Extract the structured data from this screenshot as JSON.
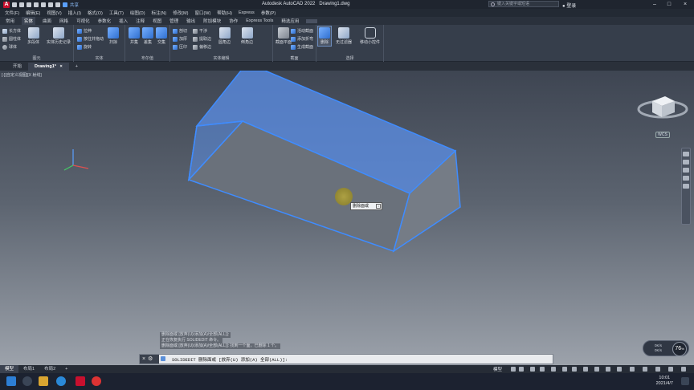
{
  "window": {
    "title": "Autodesk AutoCAD 2022",
    "filename": "Drawing1.dwg",
    "share_label": "共享",
    "search_placeholder": "键入关键字或短语",
    "login_label": "登录"
  },
  "menu": [
    "文件(F)",
    "编辑(E)",
    "视图(V)",
    "插入(I)",
    "格式(O)",
    "工具(T)",
    "绘图(D)",
    "标注(N)",
    "修改(M)",
    "窗口(W)",
    "帮助(H)",
    "Express",
    "参数(P)"
  ],
  "ribbon_tabs": [
    "常用",
    "实体",
    "曲面",
    "网格",
    "可视化",
    "参数化",
    "插入",
    "注释",
    "视图",
    "管理",
    "输出",
    "附加模块",
    "协作",
    "Express Tools",
    "精选应用"
  ],
  "ribbon_active_tab": "实体",
  "ribbon": {
    "primitive": {
      "label": "图元",
      "small": [
        "长方体",
        "圆柱体",
        "球体"
      ],
      "big": [
        "多段体"
      ]
    },
    "history": {
      "big": [
        "实体历史记录"
      ]
    },
    "solid": {
      "label": "实体",
      "small": [
        "拉伸",
        "放样",
        "旋转",
        "按住并拖动",
        "扫掠"
      ]
    },
    "boolean": {
      "label": "布尔值",
      "big": [
        "并集",
        "差集",
        "交集"
      ]
    },
    "solid_edit": {
      "label": "实体编辑",
      "small": [
        "剖切",
        "加厚",
        "压印",
        "干涉",
        "提取边",
        "偏移边"
      ],
      "big": [
        "圆角边",
        "倒角边"
      ]
    },
    "section": {
      "label": "截面",
      "big": [
        "截面平面"
      ],
      "small": [
        "活动截面",
        "添加折弯",
        "生成截面"
      ]
    },
    "selection": {
      "label": "选择",
      "big": [
        "删除",
        "无过滤器",
        "移动小控件"
      ]
    }
  },
  "doc_tabs": [
    "开始",
    "Drawing1*"
  ],
  "viewport_label": "[-][自定义视图][X 射线]",
  "tooltip": "删除面或",
  "wcs_label": "WCS",
  "command_history": [
    "删除面或 [放弃(U)/添加(A)/全部(ALL)]:",
    "正在恢复执行 SOLIDEDIT 命令。",
    "删除面或 [放弃(U)/添加(A)/全部(ALL)]: 找到一个面，已删除 1 个。"
  ],
  "command_line": "SOLIDEDIT 删除面或 [放弃(U) 添加(A) 全部(ALL)]:",
  "zoom_badge": {
    "percent": "76",
    "lines": [
      "0K/s",
      "0K/s"
    ]
  },
  "layout_tabs": [
    "模型",
    "布局1",
    "布局2"
  ],
  "status_model": "模型",
  "clock": {
    "time": "10:01",
    "date": "2021/4/7"
  },
  "colors": {
    "selection": "#3f8cff",
    "accent": "#c8102e"
  }
}
